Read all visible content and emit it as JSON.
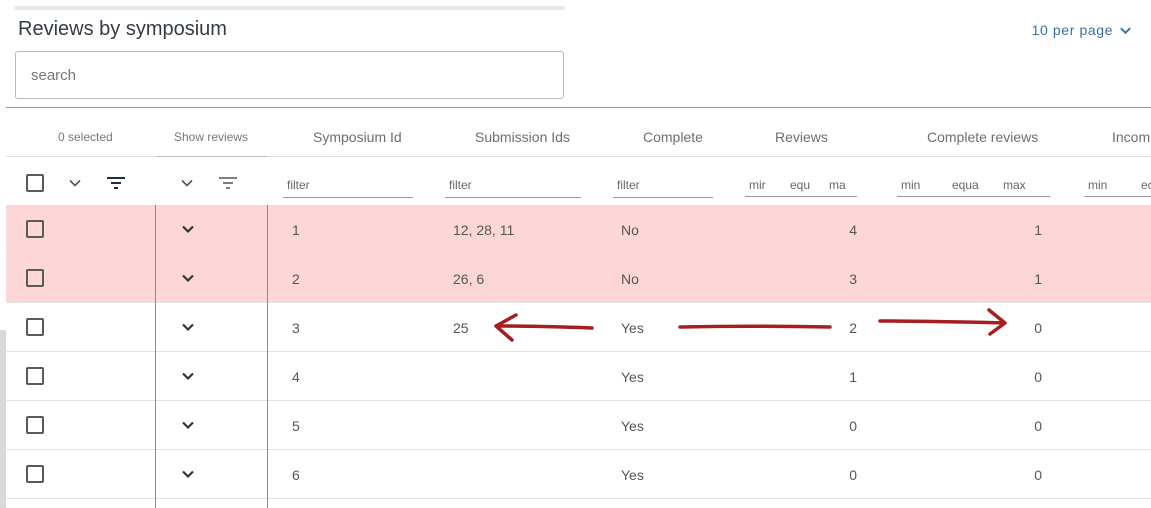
{
  "header": {
    "title": "Reviews by symposium",
    "per_page_label": "10 per page"
  },
  "search": {
    "placeholder": "search"
  },
  "columns": {
    "selected": "0 selected",
    "show_reviews": "Show reviews",
    "symposium_id": "Symposium Id",
    "submission_ids": "Submission Ids",
    "complete": "Complete",
    "reviews": "Reviews",
    "complete_reviews": "Complete reviews",
    "incomplete_reviews": "Incom"
  },
  "filters": {
    "symposium_id": "filter",
    "submission_ids": "filter",
    "complete": "filter",
    "reviews": {
      "min": "mir",
      "equal": "equ",
      "max": "ma"
    },
    "complete_reviews": {
      "min": "min",
      "equal": "equa",
      "max": "max"
    },
    "incomplete_reviews": {
      "min": "min",
      "equal": "ec"
    }
  },
  "rows": [
    {
      "symposium_id": "1",
      "submission_ids": "12, 28, 11",
      "complete": "No",
      "reviews": "4",
      "complete_reviews": "1"
    },
    {
      "symposium_id": "2",
      "submission_ids": "26, 6",
      "complete": "No",
      "reviews": "3",
      "complete_reviews": "1"
    },
    {
      "symposium_id": "3",
      "submission_ids": "25",
      "complete": "Yes",
      "reviews": "2",
      "complete_reviews": "0"
    },
    {
      "symposium_id": "4",
      "submission_ids": "",
      "complete": "Yes",
      "reviews": "1",
      "complete_reviews": "0"
    },
    {
      "symposium_id": "5",
      "submission_ids": "",
      "complete": "Yes",
      "reviews": "0",
      "complete_reviews": "0"
    },
    {
      "symposium_id": "6",
      "submission_ids": "",
      "complete": "Yes",
      "reviews": "0",
      "complete_reviews": "0"
    }
  ],
  "colors": {
    "incomplete_row": "#fdd7d7",
    "link": "#3a6fa4",
    "annotation_arrow": "#a51e22"
  },
  "icons": {
    "row_expand": "chevron-down-icon",
    "column_filter": "filter-lines-icon",
    "checkbox": "checkbox-icon"
  }
}
